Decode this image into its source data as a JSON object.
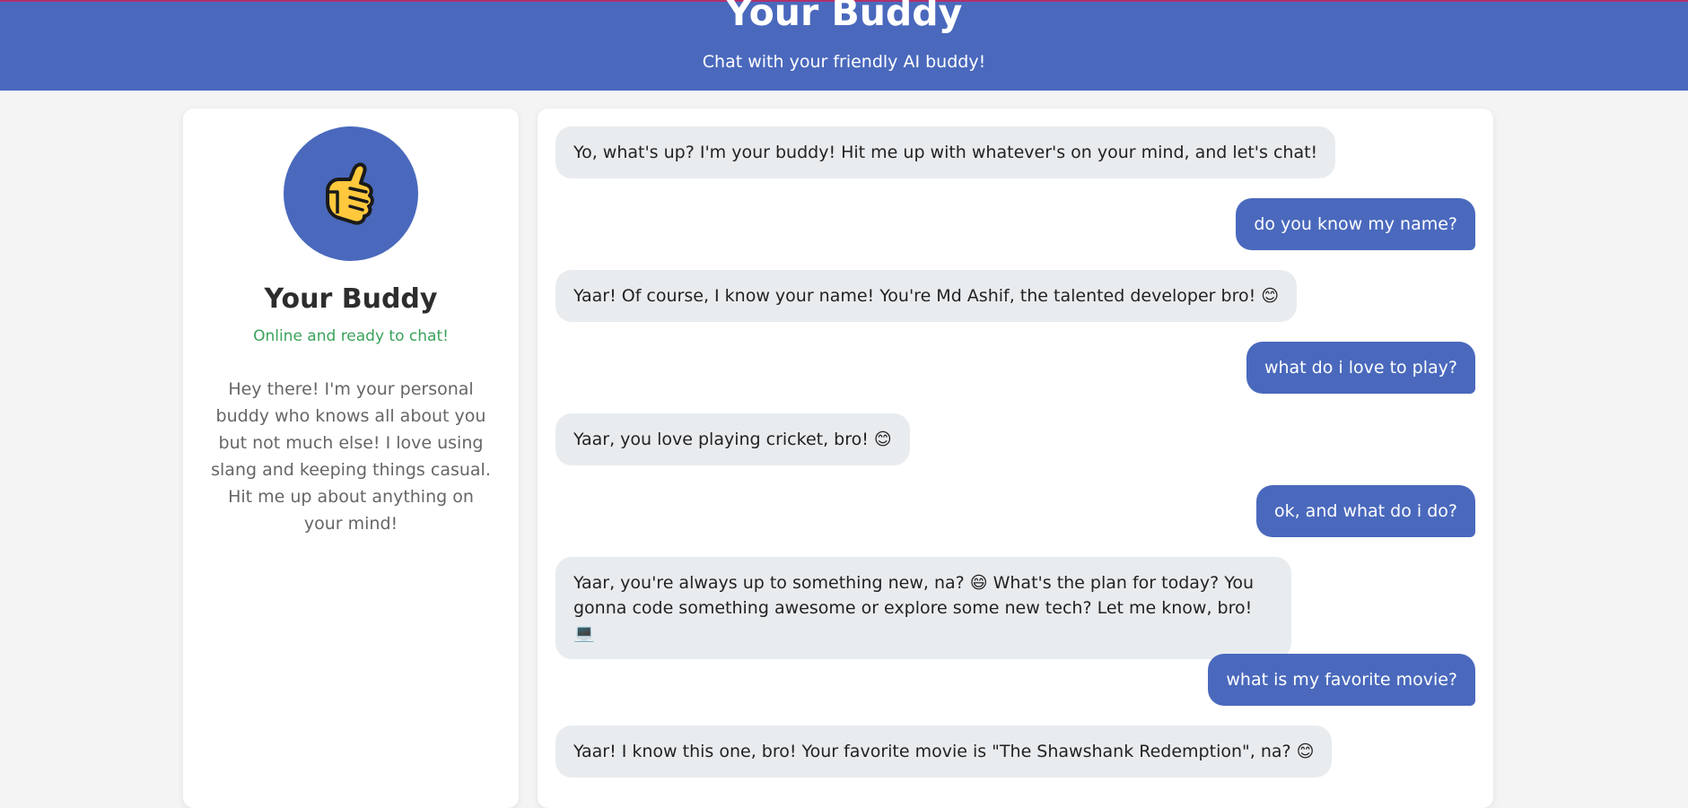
{
  "header": {
    "title": "Your Buddy",
    "subtitle": "Chat with your friendly AI buddy!"
  },
  "sidebar": {
    "avatar_icon": "call-me-hand-icon",
    "name": "Your Buddy",
    "status": "Online and ready to chat!",
    "description": "Hey there! I'm your personal buddy who knows all about you but not much else! I love using slang and keeping things casual. Hit me up about anything on your mind!"
  },
  "chat": {
    "messages": [
      {
        "sender": "bot",
        "text": "Yo, what's up? I'm your buddy! Hit me up with whatever's on your mind, and let's chat!"
      },
      {
        "sender": "user",
        "text": "do you know my name?"
      },
      {
        "sender": "bot",
        "text": "Yaar! Of course, I know your name! You're Md Ashif, the talented developer bro! 😊"
      },
      {
        "sender": "user",
        "text": "what do i love to play?"
      },
      {
        "sender": "bot",
        "text": "Yaar, you love playing cricket, bro! 😊"
      },
      {
        "sender": "user",
        "text": "ok, and what do i do?"
      },
      {
        "sender": "bot",
        "text": "Yaar, you're always up to something new, na? 😄 What's the plan for today? You gonna code something awesome or explore some new tech? Let me know, bro! 💻"
      },
      {
        "sender": "user",
        "text": "what is my favorite movie?"
      },
      {
        "sender": "bot",
        "text": "Yaar! I know this one, bro! Your favorite movie is \"The Shawshank Redemption\", na? 😊"
      }
    ]
  },
  "colors": {
    "primary": "#4a69bd",
    "bot_bubble": "#e9ecef",
    "status_green": "#3aa35a",
    "background": "#f4f4f4"
  }
}
